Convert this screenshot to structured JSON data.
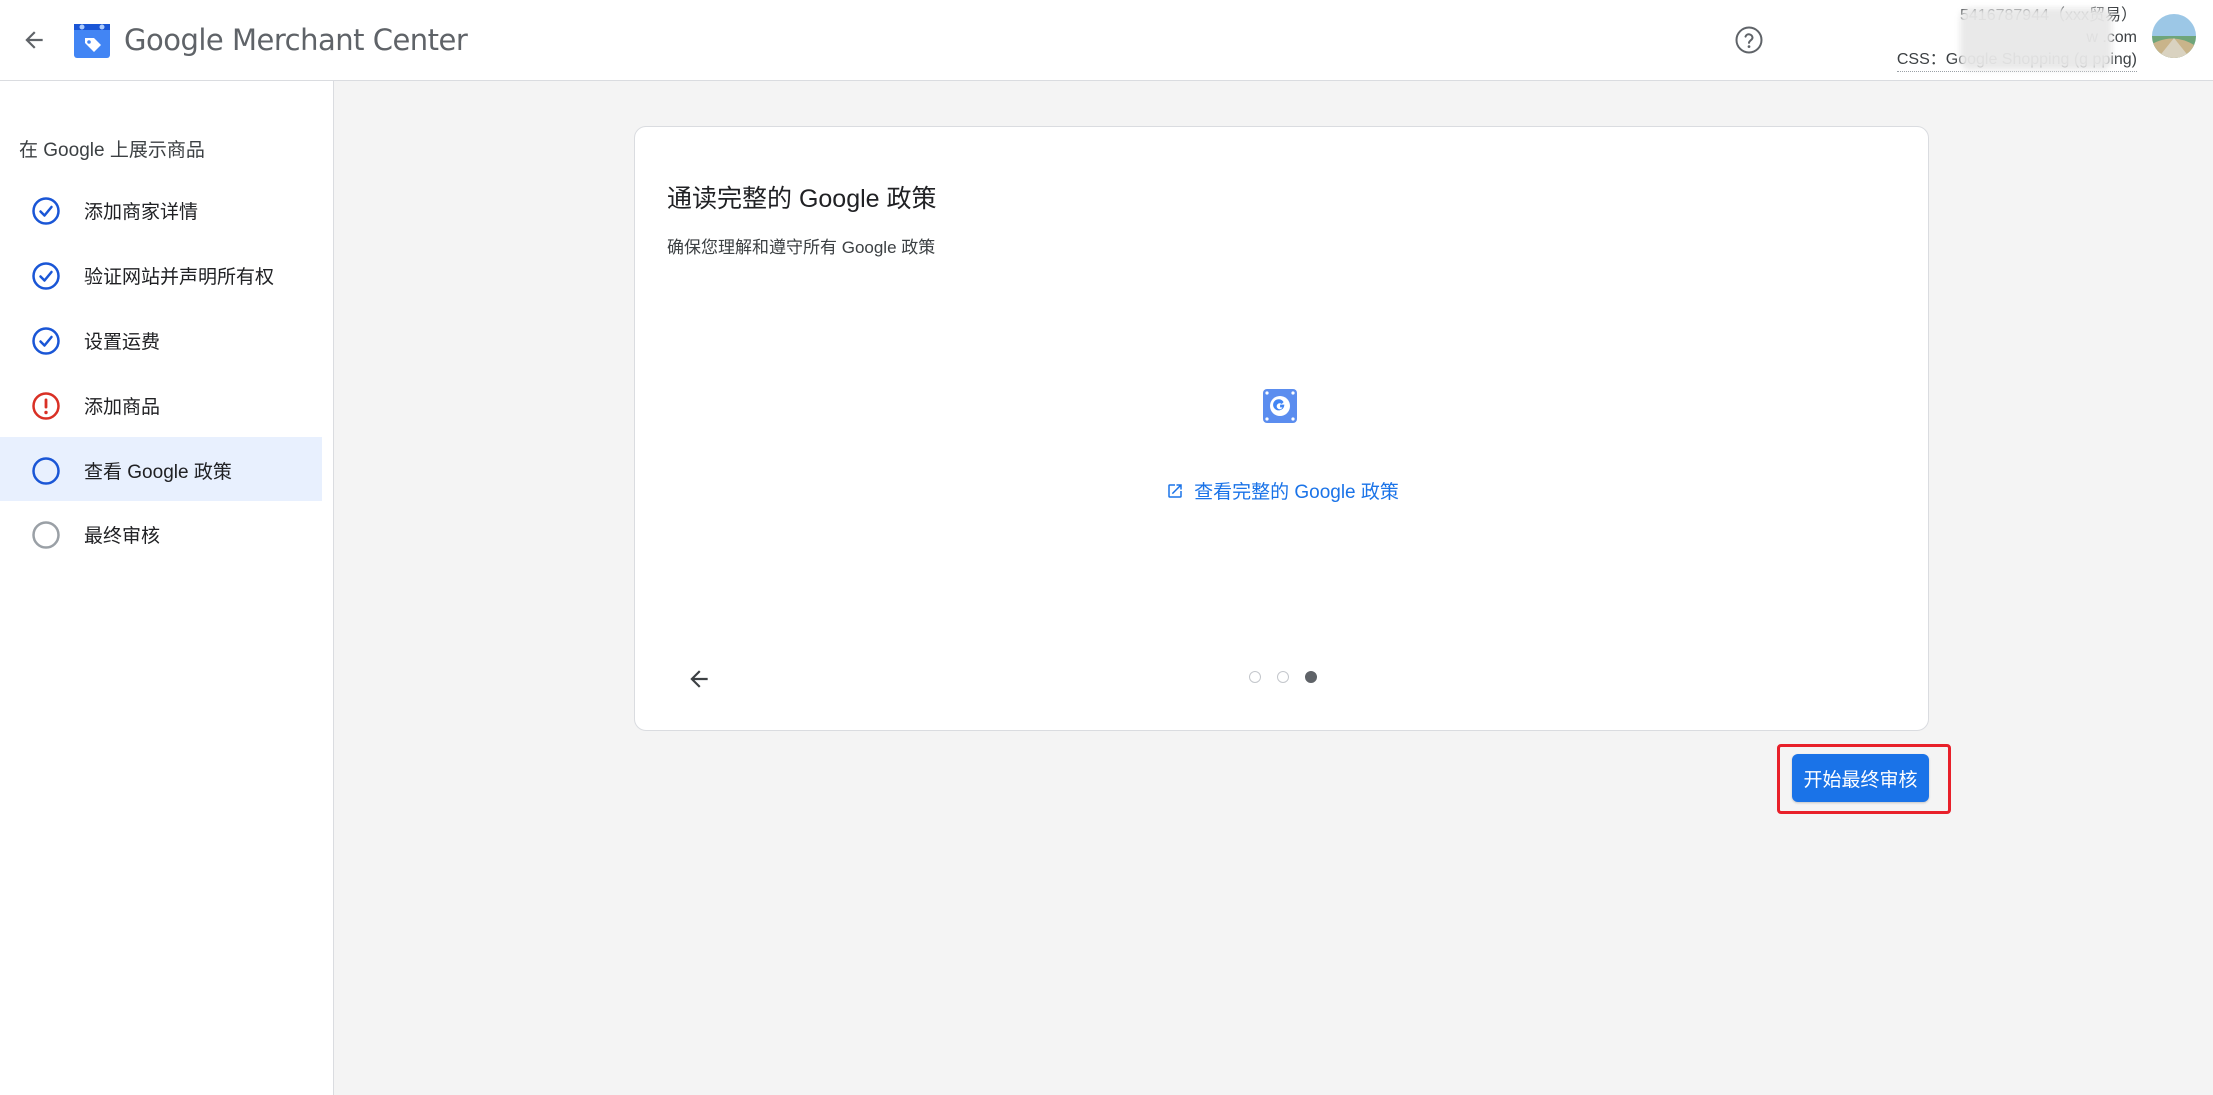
{
  "header": {
    "brand_name": "Google Merchant Center",
    "account": {
      "line1": "5416787944（xxx贸易）",
      "line2": "w                        .com",
      "line3": "CSS：Google Shopping (g                 pping)"
    }
  },
  "sidebar": {
    "heading": "在 Google 上展示商品",
    "steps": [
      {
        "label": "添加商家详情",
        "status": "complete"
      },
      {
        "label": "验证网站并声明所有权",
        "status": "complete"
      },
      {
        "label": "设置运费",
        "status": "complete"
      },
      {
        "label": "添加商品",
        "status": "error"
      },
      {
        "label": "查看 Google 政策",
        "status": "current"
      },
      {
        "label": "最终审核",
        "status": "pending"
      }
    ]
  },
  "card": {
    "title": "通读完整的 Google 政策",
    "subtitle": "确保您理解和遵守所有 Google 政策",
    "link_label": "查看完整的 Google 政策",
    "carousel": {
      "total": 3,
      "current": 3
    }
  },
  "actions": {
    "primary_label": "开始最终审核"
  },
  "colors": {
    "accent": "#1a73e8",
    "complete": "#1a56d6",
    "error": "#d93025",
    "highlight": "#e8202a"
  }
}
